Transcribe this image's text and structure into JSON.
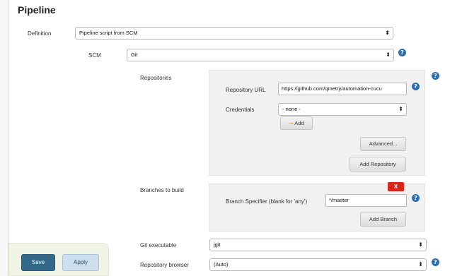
{
  "section": {
    "title": "Pipeline"
  },
  "definition": {
    "label": "Definition",
    "value": "Pipeline script from SCM"
  },
  "scm": {
    "label": "SCM",
    "value": "Git"
  },
  "repositories": {
    "label": "Repositories",
    "url_label": "Repository URL",
    "url_value": "https://github.com/qmetry/automation-cucu",
    "credentials_label": "Credentials",
    "credentials_value": "- none -",
    "add_label": "Add",
    "advanced_label": "Advanced...",
    "add_repository_label": "Add Repository"
  },
  "branches": {
    "label": "Branches to build",
    "delete_label": "X",
    "specifier_label": "Branch Specifier (blank for 'any')",
    "specifier_value": "*/master",
    "add_branch_label": "Add Branch"
  },
  "git_executable": {
    "label": "Git executable",
    "value": "jgit"
  },
  "repo_browser": {
    "label": "Repository browser",
    "value": "(Auto)"
  },
  "actions": {
    "save_label": "Save",
    "apply_label": "Apply"
  },
  "icons": {
    "help_glyph": "?",
    "select_arrow": "⬍",
    "key_glyph": "⊸"
  },
  "colors": {
    "help": "#2c6fb5",
    "delete": "#d9261c",
    "save": "#346888",
    "apply": "#cfe0ee"
  }
}
